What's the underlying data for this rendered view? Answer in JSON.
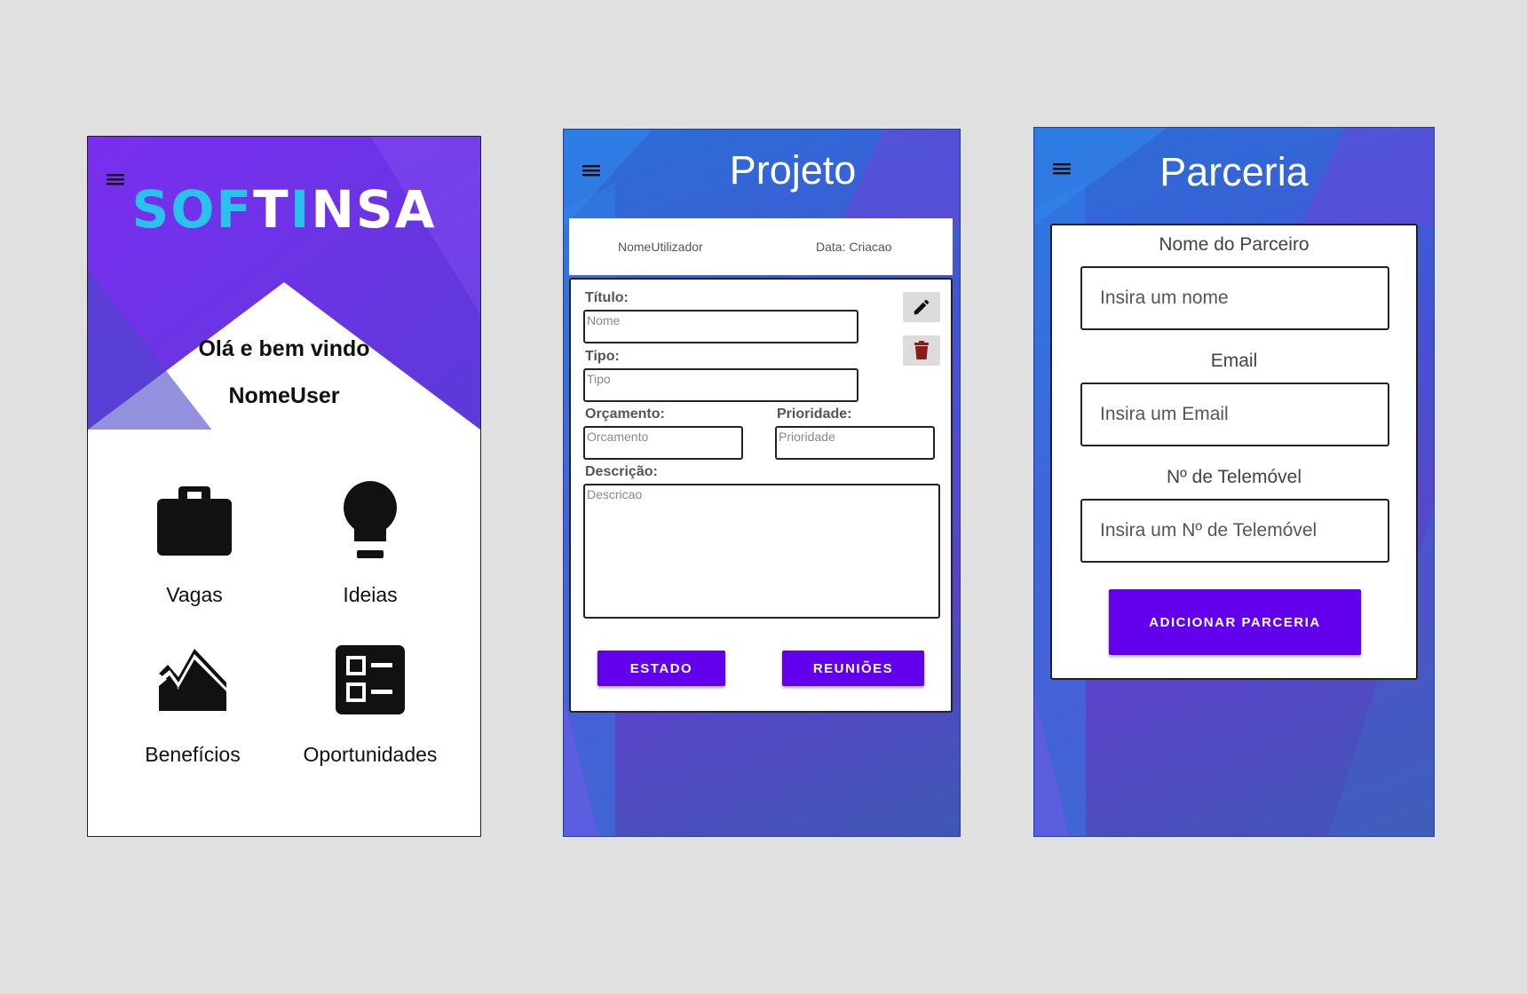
{
  "home": {
    "logo_part1": "SOF",
    "logo_part2": "T",
    "logo_part3": "I",
    "logo_part4": "NSA",
    "greeting": "Olá e bem vindo",
    "username": "NomeUser",
    "tiles": [
      {
        "label": "Vagas",
        "icon": "briefcase-icon"
      },
      {
        "label": "Ideias",
        "icon": "lightbulb-icon"
      },
      {
        "label": "Benefícios",
        "icon": "trending-down-icon"
      },
      {
        "label": "Oportunidades",
        "icon": "list-icon"
      }
    ]
  },
  "projeto": {
    "title": "Projeto",
    "user_name": "NomeUtilizador",
    "date": "Data: Criacao",
    "fields": {
      "titulo_label": "Título:",
      "titulo_placeholder": "Nome",
      "tipo_label": "Tipo:",
      "tipo_placeholder": "Tipo",
      "orcamento_label": "Orçamento:",
      "orcamento_placeholder": "Orcamento",
      "prioridade_label": "Prioridade:",
      "prioridade_placeholder": "Prioridade",
      "descricao_label": "Descrição:",
      "descricao_placeholder": "Descricao"
    },
    "buttons": {
      "estado": "ESTADO",
      "reunioes": "REUNIÕES"
    }
  },
  "parceria": {
    "title": "Parceria",
    "nome_label": "Nome do Parceiro",
    "nome_placeholder": "Insira um nome",
    "email_label": "Email",
    "email_placeholder": "Insira um Email",
    "telemovel_label": "Nº de Telemóvel",
    "telemovel_placeholder": "Insira um Nº de Telemóvel",
    "submit": "ADICIONAR PARCERIA"
  },
  "colors": {
    "background": "#e0e0e0",
    "hero_purple": "#6a30f0",
    "primary_button": "#6200ee",
    "logo_cyan": "#29c2ea",
    "delete_icon": "#8b1a1a"
  }
}
